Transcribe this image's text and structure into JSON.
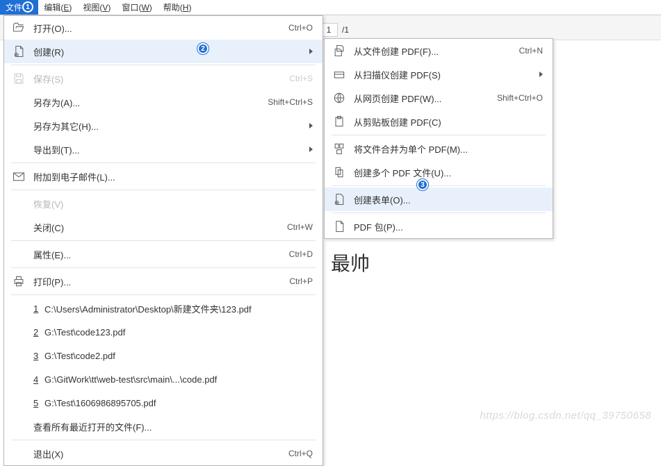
{
  "menubar": {
    "file": {
      "label": "文件",
      "accel": "F"
    },
    "edit": {
      "label": "编辑",
      "accel": "E"
    },
    "view": {
      "label": "视图",
      "accel": "V"
    },
    "window": {
      "label": "窗口",
      "accel": "W"
    },
    "help": {
      "label": "帮助",
      "accel": "H"
    }
  },
  "badges": {
    "b1": "1",
    "b2": "2",
    "b3": "3"
  },
  "page": {
    "current": "1",
    "total": "/1"
  },
  "file_menu": {
    "open": {
      "label": "打开(O)...",
      "shortcut": "Ctrl+O"
    },
    "create": {
      "label": "创建(R)",
      "shortcut": ""
    },
    "save": {
      "label": "保存(S)",
      "shortcut": "Ctrl+S"
    },
    "save_as": {
      "label": "另存为(A)...",
      "shortcut": "Shift+Ctrl+S"
    },
    "save_other": {
      "label": "另存为其它(H)...",
      "shortcut": ""
    },
    "export": {
      "label": "导出到(T)...",
      "shortcut": ""
    },
    "attach": {
      "label": "附加到电子邮件(L)...",
      "shortcut": ""
    },
    "revert": {
      "label": "恢复(V)",
      "shortcut": ""
    },
    "close": {
      "label": "关闭(C)",
      "shortcut": "Ctrl+W"
    },
    "props": {
      "label": "属性(E)...",
      "shortcut": "Ctrl+D"
    },
    "print": {
      "label": "打印(P)...",
      "shortcut": "Ctrl+P"
    },
    "recent": [
      {
        "n": "1",
        "path": "C:\\Users\\Administrator\\Desktop\\新建文件夹\\123.pdf"
      },
      {
        "n": "2",
        "path": "G:\\Test\\code123.pdf"
      },
      {
        "n": "3",
        "path": "G:\\Test\\code2.pdf"
      },
      {
        "n": "4",
        "path": "G:\\GitWork\\tt\\web-test\\src\\main\\...\\code.pdf"
      },
      {
        "n": "5",
        "path": "G:\\Test\\1606986895705.pdf"
      }
    ],
    "recent_all": {
      "label": "查看所有最近打开的文件(F)...",
      "shortcut": ""
    },
    "exit": {
      "label": "退出(X)",
      "shortcut": "Ctrl+Q"
    }
  },
  "create_menu": {
    "from_file": {
      "label": "从文件创建 PDF(F)...",
      "shortcut": "Ctrl+N"
    },
    "from_scanner": {
      "label": "从扫描仪创建 PDF(S)",
      "shortcut": ""
    },
    "from_web": {
      "label": "从网页创建 PDF(W)...",
      "shortcut": "Shift+Ctrl+O"
    },
    "from_clip": {
      "label": "从剪贴板创建 PDF(C)",
      "shortcut": ""
    },
    "merge": {
      "label": "将文件合并为单个 PDF(M)...",
      "shortcut": ""
    },
    "multi": {
      "label": "创建多个 PDF 文件(U)...",
      "shortcut": ""
    },
    "form": {
      "label": "创建表单(O)...",
      "shortcut": ""
    },
    "package": {
      "label": "PDF 包(P)...",
      "shortcut": ""
    }
  },
  "document": {
    "text": "最帅"
  },
  "watermark": "https://blog.csdn.net/qq_39750658"
}
